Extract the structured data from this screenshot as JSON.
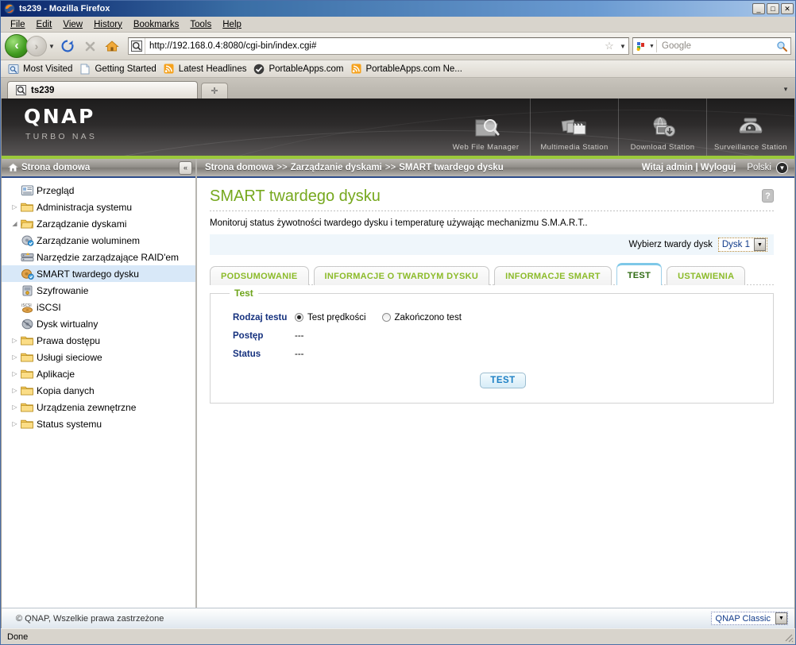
{
  "window": {
    "title": "ts239 - Mozilla Firefox",
    "minimize": "_",
    "maximize": "□",
    "close": "✕"
  },
  "menu": [
    "File",
    "Edit",
    "View",
    "History",
    "Bookmarks",
    "Tools",
    "Help"
  ],
  "nav": {
    "url": "http://192.168.0.4:8080/cgi-bin/index.cgi#",
    "search_placeholder": "Google",
    "back_icon": "back-arrow-icon",
    "forward_icon": "forward-arrow-icon",
    "reload_icon": "reload-icon",
    "stop_icon": "stop-icon",
    "home_icon": "home-icon"
  },
  "bookmarks": [
    {
      "label": "Most Visited",
      "icon": "most-visited-icon"
    },
    {
      "label": "Getting Started",
      "icon": "page-icon"
    },
    {
      "label": "Latest Headlines",
      "icon": "rss-icon"
    },
    {
      "label": "PortableApps.com",
      "icon": "portableapps-icon"
    },
    {
      "label": "PortableApps.com Ne...",
      "icon": "rss-icon"
    }
  ],
  "tabs": {
    "active_label": "ts239",
    "new_tab_label": "+",
    "list_label": "▾"
  },
  "banner": {
    "logo": "QNAP",
    "tagline": "TURBO NAS",
    "apps": [
      {
        "label": "Web File Manager",
        "icon": "web-file-manager-icon"
      },
      {
        "label": "Multimedia Station",
        "icon": "multimedia-station-icon"
      },
      {
        "label": "Download Station",
        "icon": "download-station-icon"
      },
      {
        "label": "Surveillance Station",
        "icon": "surveillance-station-icon"
      }
    ]
  },
  "sidebar": {
    "header": "Strona domowa",
    "collapse_label": "«",
    "items": [
      {
        "label": "Przegląd",
        "icon": "overview-icon",
        "level": 1,
        "twisty": "none",
        "selected": false
      },
      {
        "label": "Administracja systemu",
        "icon": "folder-icon",
        "level": 1,
        "twisty": "collapsed",
        "selected": false
      },
      {
        "label": "Zarządzanie dyskami",
        "icon": "folder-open-icon",
        "level": 1,
        "twisty": "expanded",
        "selected": false
      },
      {
        "label": "Zarządzanie woluminem",
        "icon": "volume-management-icon",
        "level": 2,
        "twisty": "none",
        "selected": false
      },
      {
        "label": "Narzędzie zarządzające RAID'em",
        "icon": "raid-tool-icon",
        "level": 2,
        "twisty": "none",
        "selected": false
      },
      {
        "label": "SMART twardego dysku",
        "icon": "smart-disk-icon",
        "level": 2,
        "twisty": "none",
        "selected": true
      },
      {
        "label": "Szyfrowanie",
        "icon": "encryption-icon",
        "level": 2,
        "twisty": "none",
        "selected": false
      },
      {
        "label": "iSCSI",
        "icon": "iscsi-icon",
        "level": 2,
        "twisty": "none",
        "selected": false
      },
      {
        "label": "Dysk wirtualny",
        "icon": "virtual-disk-icon",
        "level": 2,
        "twisty": "none",
        "selected": false
      },
      {
        "label": "Prawa dostępu",
        "icon": "folder-icon",
        "level": 1,
        "twisty": "collapsed",
        "selected": false
      },
      {
        "label": "Usługi sieciowe",
        "icon": "folder-icon",
        "level": 1,
        "twisty": "collapsed",
        "selected": false
      },
      {
        "label": "Aplikacje",
        "icon": "folder-icon",
        "level": 1,
        "twisty": "collapsed",
        "selected": false
      },
      {
        "label": "Kopia danych",
        "icon": "folder-icon",
        "level": 1,
        "twisty": "collapsed",
        "selected": false
      },
      {
        "label": "Urządzenia zewnętrzne",
        "icon": "folder-icon",
        "level": 1,
        "twisty": "collapsed",
        "selected": false
      },
      {
        "label": "Status systemu",
        "icon": "folder-icon",
        "level": 1,
        "twisty": "collapsed",
        "selected": false
      }
    ]
  },
  "breadcrumb": {
    "parts": [
      "Strona domowa",
      "Zarządzanie dyskami",
      "SMART twardego dysku"
    ],
    "separator": ">>",
    "welcome": "Witaj admin | Wyloguj",
    "language": "Polski"
  },
  "main": {
    "title": "SMART twardego dysku",
    "help_label": "?",
    "description": "Monitoruj status żywotności twardego dysku i temperaturę używając mechanizmu S.M.A.R.T..",
    "disk_select_label": "Wybierz twardy dysk",
    "disk_select_value": "Dysk 1",
    "tabs": [
      {
        "label": "PODSUMOWANIE",
        "active": false
      },
      {
        "label": "INFORMACJE O TWARDYM DYSKU",
        "active": false
      },
      {
        "label": "INFORMACJE SMART",
        "active": false
      },
      {
        "label": "TEST",
        "active": true
      },
      {
        "label": "USTAWIENIA",
        "active": false
      }
    ],
    "panel": {
      "legend": "Test",
      "test_type_label": "Rodzaj testu",
      "options": [
        {
          "label": "Test prędkości",
          "checked": true
        },
        {
          "label": "Zakończono test",
          "checked": false
        }
      ],
      "progress_label": "Postęp",
      "progress_value": "---",
      "status_label": "Status",
      "status_value": "---",
      "button_label": "TEST"
    }
  },
  "footer": {
    "copyright": "© QNAP, Wszelkie prawa zastrzeżone",
    "theme_value": "QNAP Classic"
  },
  "statusbar": {
    "text": "Done"
  },
  "colors": {
    "accent_green": "#76a81e",
    "banner_green_rule": "#9bc93a",
    "tab_label_green": "#8cbb2a",
    "form_label_blue": "#15317e",
    "button_blue": "#1b7fc4",
    "selection_blue": "#d8e8f8"
  }
}
